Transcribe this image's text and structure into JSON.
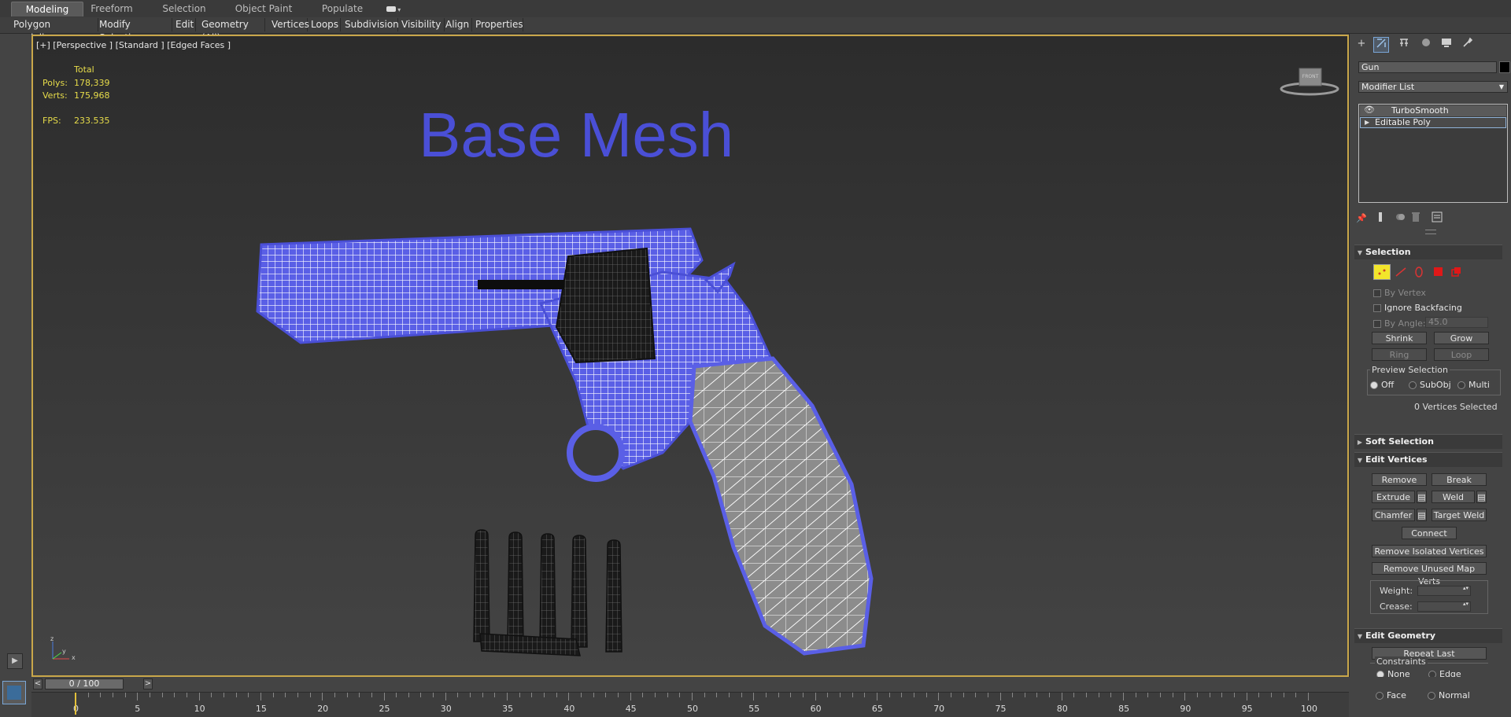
{
  "ribbon": {
    "tabs": [
      "Modeling",
      "Freeform",
      "Selection",
      "Object Paint",
      "Populate"
    ],
    "active_tab": "Modeling",
    "tools": [
      "Polygon Modeling",
      "Modify Selection",
      "Edit",
      "Geometry (All)",
      "Vertices",
      "Loops",
      "Subdivision",
      "Visibility",
      "Align",
      "Properties"
    ]
  },
  "viewport": {
    "label": "[+] [Perspective ] [Standard ] [Edged Faces ]",
    "stats": {
      "total_label": "Total",
      "polys_label": "Polys:",
      "polys_value": "178,339",
      "verts_label": "Verts:",
      "verts_value": "175,968",
      "fps_label": "FPS:",
      "fps_value": "233.535"
    },
    "scene_title": "Base Mesh",
    "viewcube_label": "FRONT",
    "axis": {
      "z": "z",
      "x": "x",
      "y": "y"
    }
  },
  "command_panel": {
    "object_name": "Gun",
    "object_color": "#000000",
    "modifier_list_label": "Modifier List",
    "stack": [
      "TurboSmooth",
      "Editable Poly"
    ],
    "selection": {
      "title": "Selection",
      "by_vertex": "By Vertex",
      "ignore_backfacing": "Ignore Backfacing",
      "by_angle": "By Angle:",
      "by_angle_value": "45.0",
      "shrink": "Shrink",
      "grow": "Grow",
      "ring": "Ring",
      "loop": "Loop",
      "preview_title": "Preview Selection",
      "preview_options": [
        "Off",
        "SubObj",
        "Multi"
      ],
      "status": "0 Vertices Selected"
    },
    "soft_selection": "Soft Selection",
    "edit_vertices": {
      "title": "Edit Vertices",
      "remove": "Remove",
      "break": "Break",
      "extrude": "Extrude",
      "weld": "Weld",
      "chamfer": "Chamfer",
      "target_weld": "Target Weld",
      "connect": "Connect",
      "remove_isolated": "Remove Isolated Vertices",
      "remove_unused": "Remove Unused Map Verts",
      "weight_label": "Weight:",
      "crease_label": "Crease:"
    },
    "edit_geometry": {
      "title": "Edit Geometry",
      "repeat_last": "Repeat Last",
      "constraints_title": "Constraints",
      "constraints": [
        "None",
        "Edge",
        "Face",
        "Normal"
      ]
    }
  },
  "timeline": {
    "frame_display": "0 / 100",
    "ticks": [
      "0",
      "5",
      "10",
      "15",
      "20",
      "25",
      "30",
      "35",
      "40",
      "45",
      "50",
      "55",
      "60",
      "65",
      "70",
      "75",
      "80",
      "85",
      "90",
      "95",
      "100"
    ]
  },
  "colors": {
    "wire_blue": "#5257e0",
    "viewport_border": "#c9a74a",
    "stats_yellow": "#e7dc4a",
    "vertex_active": "#f2e52b",
    "element_red": "#e01818"
  }
}
